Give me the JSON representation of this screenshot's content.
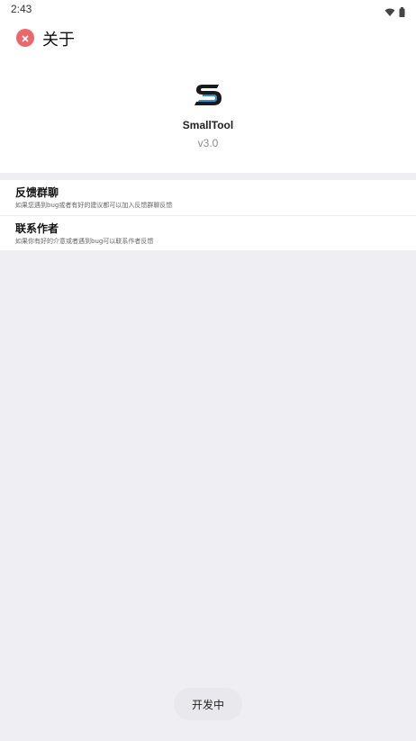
{
  "status_bar": {
    "time": "2:43",
    "icons": [
      "wifi-icon",
      "battery-icon"
    ]
  },
  "header": {
    "title": "关于",
    "close_icon": "close-icon"
  },
  "app": {
    "logo_icon": "smalltool-s-logo",
    "name": "SmallTool",
    "version": "v3.0"
  },
  "list": {
    "items": [
      {
        "title": "反馈群聊",
        "description": "如果您遇到bug或者有好的建议都可以加入反馈群聊反馈"
      },
      {
        "title": "联系作者",
        "description": "如果你有好的介意或者遇到bug可以联系作者反馈"
      }
    ]
  },
  "toast": {
    "text": "开发中"
  },
  "colors": {
    "accent_close": "#e8686b",
    "logo_primary": "#1a1a1a",
    "logo_secondary": "#2b8fd6",
    "background": "#efeef3"
  }
}
